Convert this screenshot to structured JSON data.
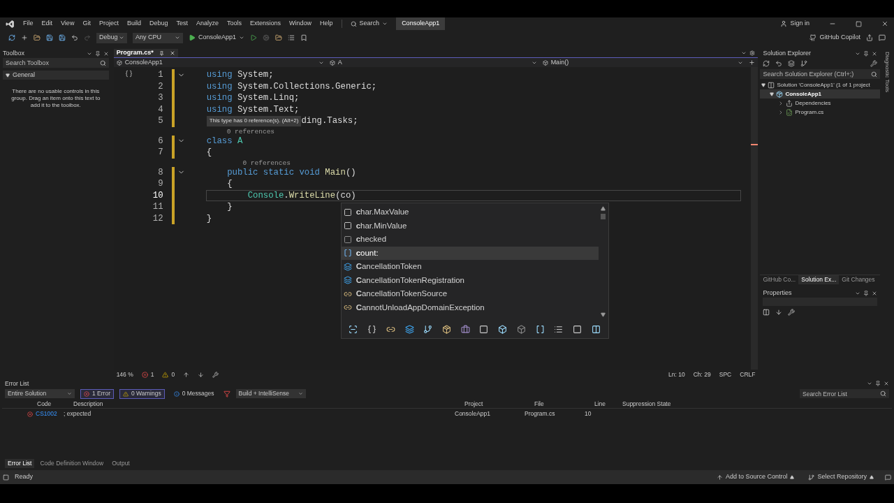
{
  "menu": [
    "File",
    "Edit",
    "View",
    "Git",
    "Project",
    "Build",
    "Debug",
    "Test",
    "Analyze",
    "Tools",
    "Extensions",
    "Window",
    "Help"
  ],
  "search": {
    "label": "Search"
  },
  "solution_name": "ConsoleApp1",
  "account": {
    "label": "Sign in"
  },
  "copilot": {
    "label": "GitHub Copilot"
  },
  "toolbar": {
    "configuration": "Debug",
    "platform": "Any CPU",
    "start": "ConsoleApp1"
  },
  "toolbox": {
    "title": "Toolbox",
    "search": {
      "placeholder": "Search Toolbox"
    },
    "group": {
      "label": "General",
      "expanded": true
    },
    "message": "There are no usable controls in this group. Drag an item onto this text to add it to the toolbox."
  },
  "editor": {
    "tabs": [
      {
        "label": "Program.cs*",
        "selected": true
      }
    ],
    "nav": [
      "ConsoleApp1",
      "A",
      "Main()"
    ],
    "lines": [
      {
        "kind": "code",
        "number": "1",
        "expanded": true,
        "current": false,
        "tokens": [
          {
            "kind": "keyword",
            "text": "using"
          },
          {
            "kind": "plain",
            "text": " System;"
          }
        ]
      },
      {
        "kind": "code",
        "number": "2",
        "current": false,
        "tokens": [
          {
            "kind": "keyword",
            "text": "using"
          },
          {
            "kind": "plain",
            "text": " System.Collections.Generic;"
          }
        ]
      },
      {
        "kind": "code",
        "number": "3",
        "current": false,
        "tokens": [
          {
            "kind": "keyword",
            "text": "using"
          },
          {
            "kind": "plain",
            "text": " System.Linq;"
          }
        ]
      },
      {
        "kind": "code",
        "number": "4",
        "current": false,
        "tokens": [
          {
            "kind": "keyword",
            "text": "using"
          },
          {
            "kind": "plain",
            "text": " System.Text;"
          }
        ]
      },
      {
        "kind": "code",
        "number": "5",
        "current": false,
        "tooltip": "This type has 0 reference(s). (Alt+2)",
        "tokens": [
          {
            "kind": "plain",
            "text": "ding.Tasks;"
          }
        ]
      },
      {
        "kind": "codelens",
        "text": "0 references"
      },
      {
        "kind": "code",
        "number": "6",
        "expanded": true,
        "current": false,
        "tokens": [
          {
            "kind": "keyword",
            "text": "class"
          },
          {
            "kind": "type",
            "text": " A"
          }
        ]
      },
      {
        "kind": "code",
        "number": "7",
        "current": false,
        "tokens": [
          {
            "kind": "plain",
            "text": "{"
          }
        ]
      },
      {
        "kind": "codelens",
        "text": "    0 references"
      },
      {
        "kind": "code",
        "number": "8",
        "expanded": true,
        "current": false,
        "tokens": [
          {
            "kind": "keyword",
            "text": "    public static void"
          },
          {
            "kind": "method",
            "text": " Main"
          },
          {
            "kind": "plain",
            "text": "()"
          }
        ]
      },
      {
        "kind": "code",
        "number": "9",
        "current": false,
        "tokens": [
          {
            "kind": "plain",
            "text": "    {"
          }
        ]
      },
      {
        "kind": "code",
        "number": "10",
        "current": true,
        "tokens": [
          {
            "kind": "type",
            "text": "        Console"
          },
          {
            "kind": "plain",
            "text": "."
          },
          {
            "kind": "method",
            "text": "WriteLine"
          },
          {
            "kind": "plain",
            "text": "(co)"
          }
        ]
      },
      {
        "kind": "code",
        "number": "11",
        "current": false,
        "tokens": [
          {
            "kind": "plain",
            "text": "    }"
          }
        ]
      },
      {
        "kind": "code",
        "number": "12",
        "current": false,
        "tokens": [
          {
            "kind": "plain",
            "text": "}"
          }
        ]
      }
    ],
    "completion": {
      "items": [
        {
          "kind": "field",
          "text": "**c**har.MaxValue",
          "selected": false
        },
        {
          "kind": "field",
          "text": "**c**har.MinValue",
          "selected": false
        },
        {
          "kind": "keyword",
          "text": "**c**hecked",
          "selected": false
        },
        {
          "kind": "parameter",
          "text": "**c**ount:",
          "selected": true
        },
        {
          "kind": "struct",
          "text": "**C**ancellationToken",
          "selected": false
        },
        {
          "kind": "struct",
          "text": "**C**ancellationTokenRegistration",
          "selected": false
        },
        {
          "kind": "class",
          "text": "**C**ancellationTokenSource",
          "selected": false
        },
        {
          "kind": "class",
          "text": "**C**annotUnloadAppDomainException",
          "selected": false
        }
      ]
    },
    "status": {
      "zoom": "146 %",
      "errors": "1",
      "warnings": "0",
      "line": "Ln: 10",
      "column": "Ch: 29",
      "whitespace": "SPC",
      "line_ending": "CRLF"
    }
  },
  "error_list": {
    "title": "Error List",
    "scope": "Entire Solution",
    "filters": [
      {
        "kind": "error",
        "label": "1 Error",
        "on": true
      },
      {
        "kind": "warning",
        "label": "0 Warnings",
        "on": true
      },
      {
        "kind": "message",
        "label": "0 Messages",
        "on": false
      }
    ],
    "source": "Build + IntelliSense",
    "search": {
      "placeholder": "Search Error List"
    },
    "columns": [
      "Code",
      "Description",
      "Project",
      "File",
      "Line",
      "Suppression State"
    ],
    "rows": [
      {
        "code": "CS1002",
        "description": "; expected",
        "project": "ConsoleApp1",
        "file": "Program.cs",
        "line": "10"
      }
    ]
  },
  "bottom_tabs": [
    {
      "label": "Error List",
      "selected": true
    },
    {
      "label": "Code Definition Window",
      "selected": false
    },
    {
      "label": "Output",
      "selected": false
    }
  ],
  "solution_explorer": {
    "title": "Solution Explorer",
    "search": {
      "placeholder": "Search Solution Explorer (Ctrl+;)"
    },
    "tree": [
      {
        "kind": "solution",
        "label": "Solution 'ConsoleApp1' (1 of 1 project",
        "expanded": true,
        "selected": false,
        "children": [
          {
            "kind": "project",
            "label": "ConsoleApp1",
            "expanded": true,
            "selected": true,
            "children": [
              {
                "kind": "dependencies",
                "label": "Dependencies",
                "expanded": false,
                "selected": false
              },
              {
                "kind": "csharp",
                "label": "Program.cs",
                "expanded": false,
                "selected": false
              }
            ]
          }
        ]
      }
    ],
    "tabs": [
      {
        "label": "GitHub Co...",
        "selected": false
      },
      {
        "label": "Solution Ex...",
        "selected": true
      },
      {
        "label": "Git Changes",
        "selected": false
      }
    ]
  },
  "properties": {
    "title": "Properties"
  },
  "side_tab": "Diagnostic Tools",
  "status_bar": {
    "state": "Ready",
    "source_control": "Add to Source Control",
    "repository": "Select Repository"
  }
}
